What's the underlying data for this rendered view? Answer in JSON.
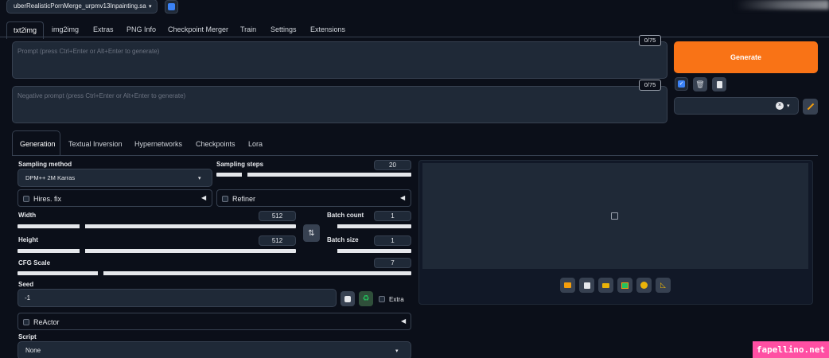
{
  "model": {
    "selected": "uberRealisticPornMerge_urpmv13Inpainting.sa"
  },
  "tabs": [
    "txt2img",
    "img2img",
    "Extras",
    "PNG Info",
    "Checkpoint Merger",
    "Train",
    "Settings",
    "Extensions"
  ],
  "prompt": {
    "placeholder": "Prompt (press Ctrl+Enter or Alt+Enter to generate)",
    "counter": "0/75"
  },
  "negative": {
    "placeholder": "Negative prompt (press Ctrl+Enter or Alt+Enter to generate)",
    "counter": "0/75"
  },
  "generate_label": "Generate",
  "subtabs": [
    "Generation",
    "Textual Inversion",
    "Hypernetworks",
    "Checkpoints",
    "Lora"
  ],
  "sampling": {
    "method_label": "Sampling method",
    "method_value": "DPM++ 2M Karras",
    "steps_label": "Sampling steps",
    "steps_value": "20",
    "steps_fraction": 0.13
  },
  "hires_label": "Hires. fix",
  "refiner_label": "Refiner",
  "width": {
    "label": "Width",
    "value": "512"
  },
  "height": {
    "label": "Height",
    "value": "512"
  },
  "batch_count": {
    "label": "Batch count",
    "value": "1"
  },
  "batch_size": {
    "label": "Batch size",
    "value": "1"
  },
  "cfg": {
    "label": "CFG Scale",
    "value": "7"
  },
  "seed": {
    "label": "Seed",
    "value": "-1",
    "extra_label": "Extra"
  },
  "reactor_label": "ReActor",
  "script": {
    "label": "Script",
    "value": "None"
  },
  "icons": {
    "swap": "swap-arrows-icon",
    "dice": "dice-icon",
    "recycle": "recycle-icon"
  },
  "watermark": "fapellino.net"
}
